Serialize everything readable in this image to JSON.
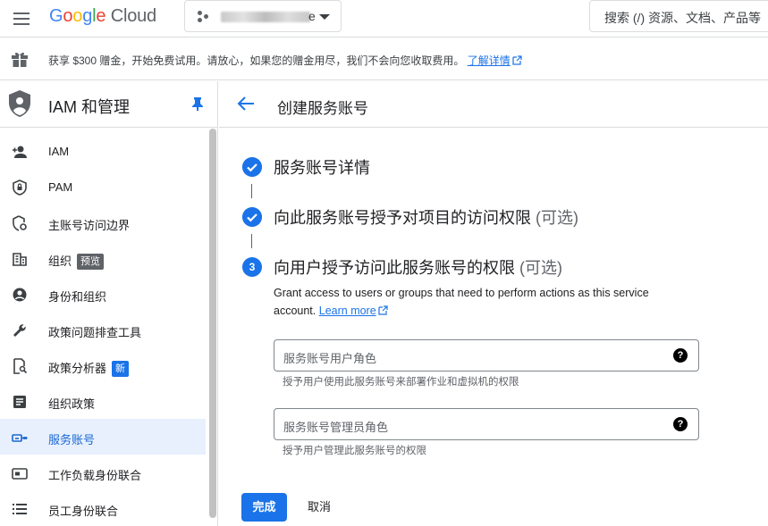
{
  "topbar": {
    "logo_letters": [
      "G",
      "o",
      "o",
      "g",
      "l",
      "e"
    ],
    "logo_suffix": " Cloud",
    "project_name_tail": "e",
    "search_placeholder": "搜索 (/) 资源、文档、产品等"
  },
  "banner": {
    "text": "获享 $300 赠金，开始免费试用。请放心，如果您的赠金用尽，我们不会向您收取费用。",
    "link": "了解详情"
  },
  "sidebar": {
    "title": "IAM 和管理",
    "items": [
      {
        "label": "IAM"
      },
      {
        "label": "PAM"
      },
      {
        "label": "主账号访问边界"
      },
      {
        "label": "组织",
        "badge": "预览"
      },
      {
        "label": "身份和组织"
      },
      {
        "label": "政策问题排查工具"
      },
      {
        "label": "政策分析器",
        "badge": "新"
      },
      {
        "label": "组织政策"
      },
      {
        "label": "服务账号",
        "active": true
      },
      {
        "label": "工作负载身份联合"
      },
      {
        "label": "员工身份联合"
      }
    ]
  },
  "main": {
    "page_title": "创建服务账号",
    "steps": [
      {
        "title": "服务账号详情",
        "optional": "",
        "state": "done"
      },
      {
        "title": "向此服务账号授予对项目的访问权限",
        "optional": "(可选)",
        "state": "done"
      },
      {
        "title": "向用户授予访问此服务账号的权限",
        "optional": "(可选)",
        "state": "current",
        "number": "3"
      }
    ],
    "description": "Grant access to users or groups that need to perform actions as this service account.",
    "learn_more": "Learn more",
    "fields": [
      {
        "placeholder": "服务账号用户角色",
        "hint": "授予用户使用此服务账号来部署作业和虚拟机的权限"
      },
      {
        "placeholder": "服务账号管理员角色",
        "hint": "授予用户管理此服务账号的权限"
      }
    ],
    "done_button": "完成",
    "cancel_button": "取消"
  },
  "colors": {
    "accent": "#1a73e8",
    "active_nav_bg": "#e8f0fe",
    "border": "#dadce0"
  }
}
